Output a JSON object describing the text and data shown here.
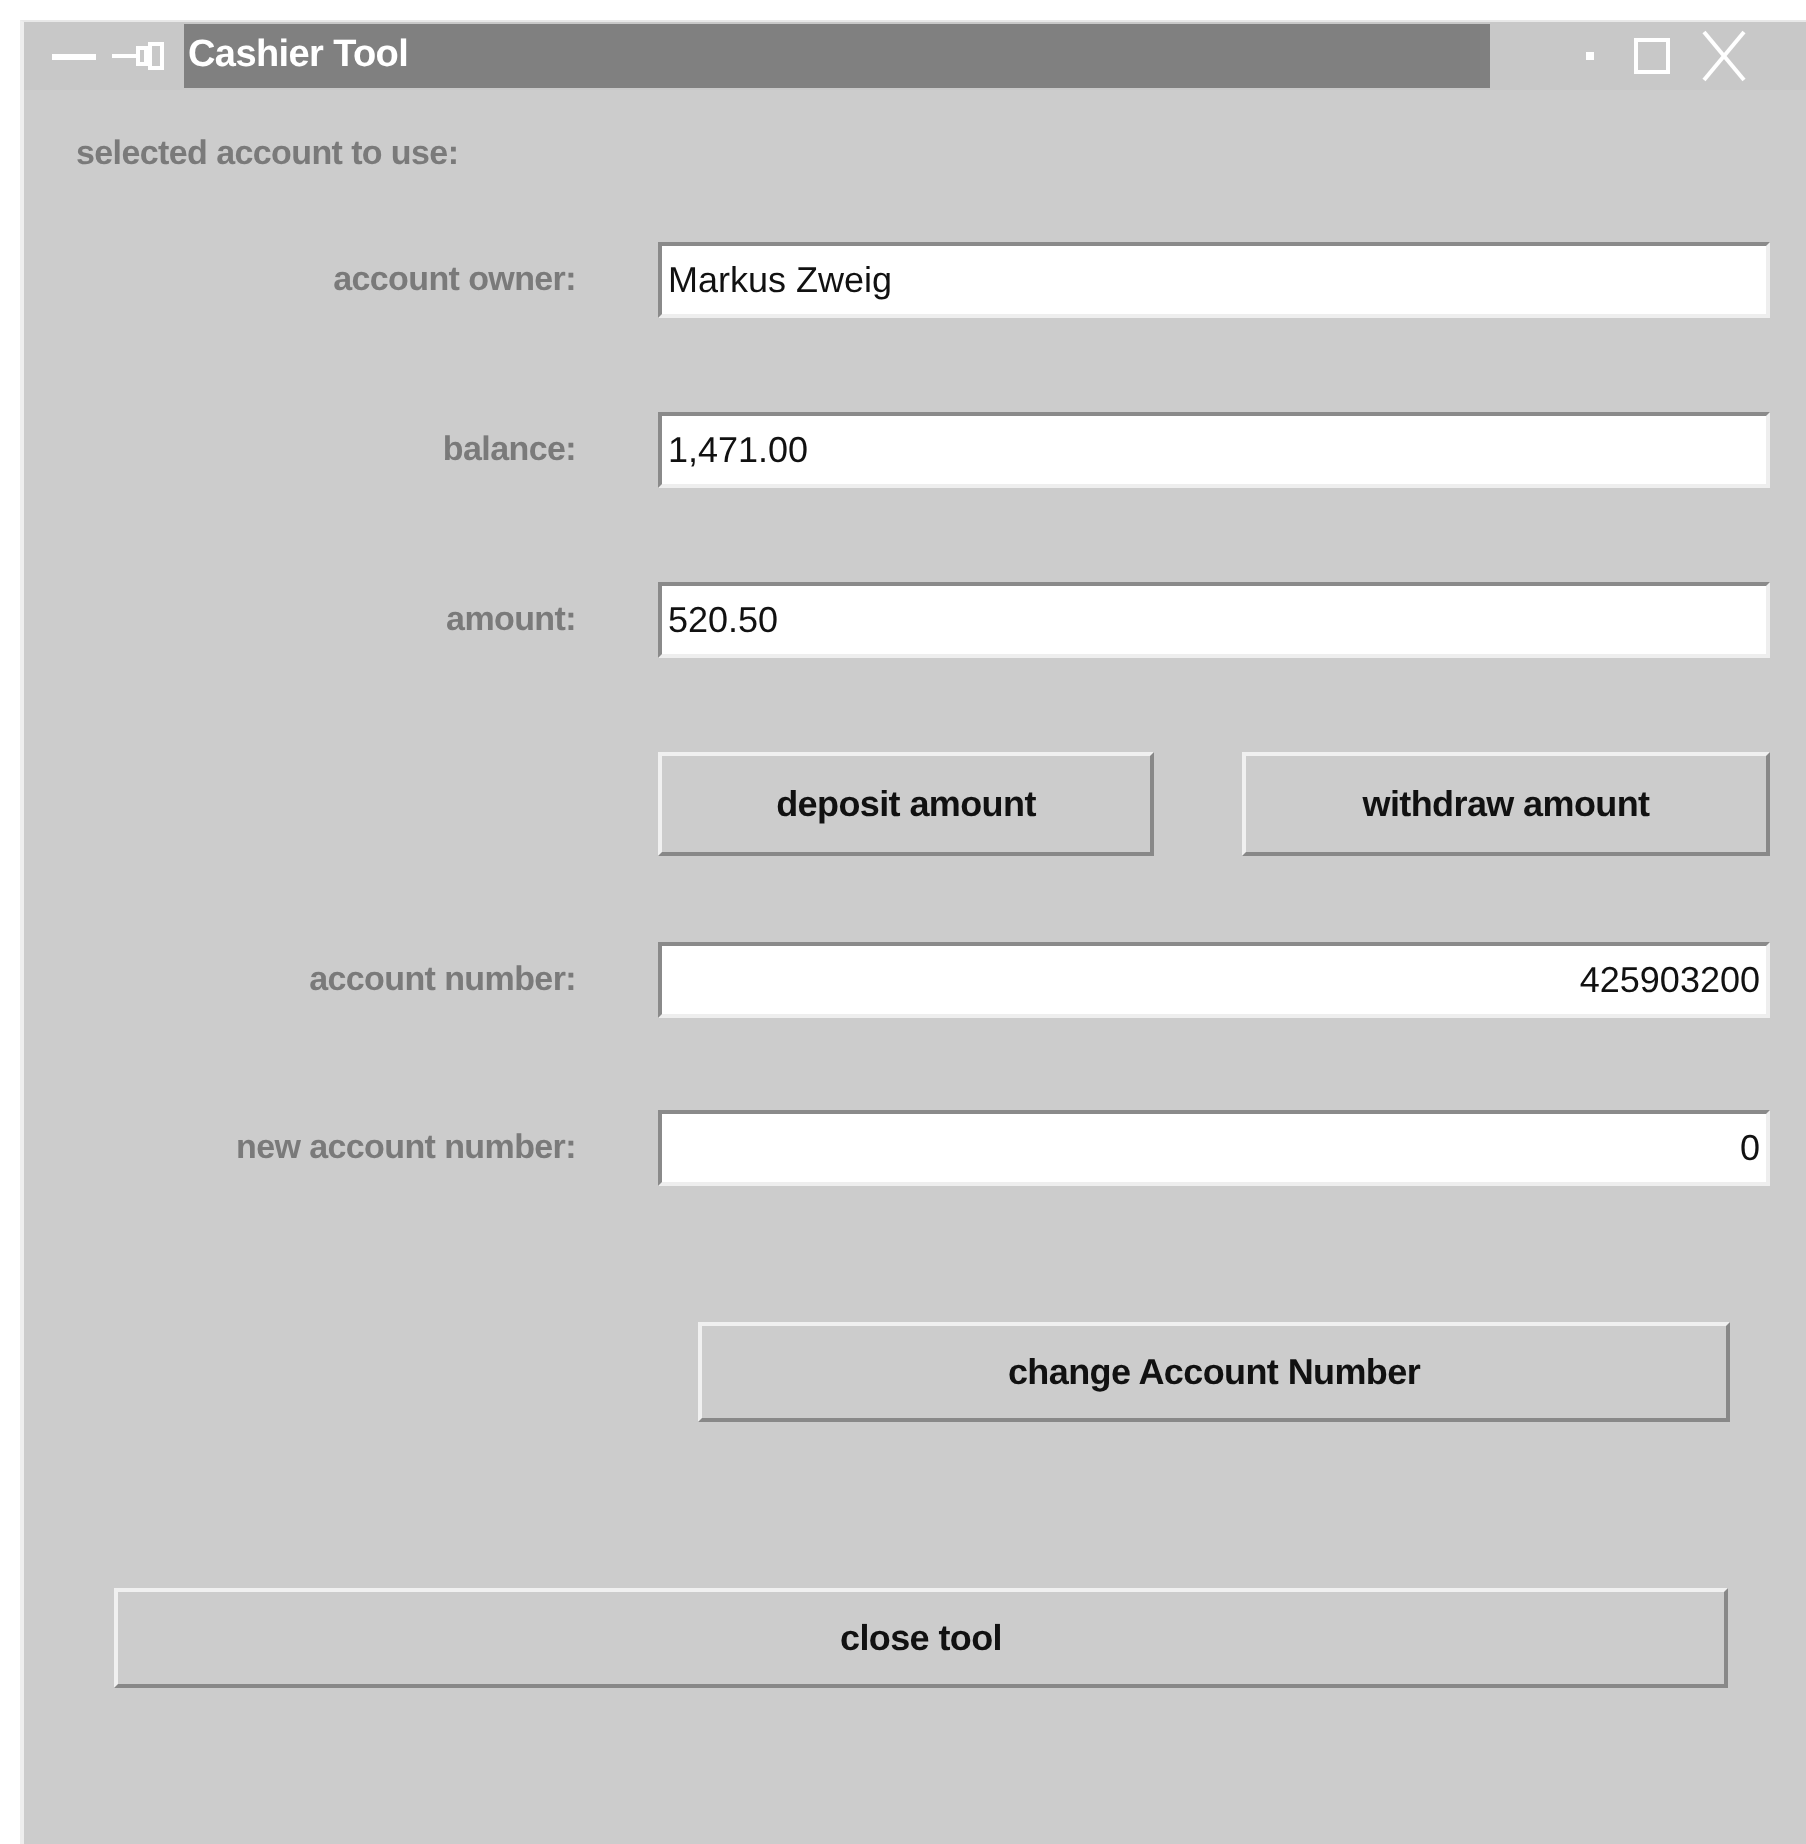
{
  "window": {
    "title": "Cashier Tool"
  },
  "heading": "selected account to use:",
  "account_fields": [
    {
      "label": "account owner:",
      "value": "Markus Zweig",
      "kind": "text"
    },
    {
      "label": "balance:",
      "value": "1,471.00",
      "kind": "text"
    },
    {
      "label": "amount:",
      "value": "520.50",
      "kind": "text"
    }
  ],
  "amount_buttons": [
    "deposit amount",
    "withdraw amount"
  ],
  "number_fields": [
    {
      "label": "account number:",
      "value": "425903200",
      "kind": "number"
    },
    {
      "label": "new account number:",
      "value": "0",
      "kind": "number"
    }
  ],
  "change_button": "change Account Number",
  "close_button": "close tool"
}
